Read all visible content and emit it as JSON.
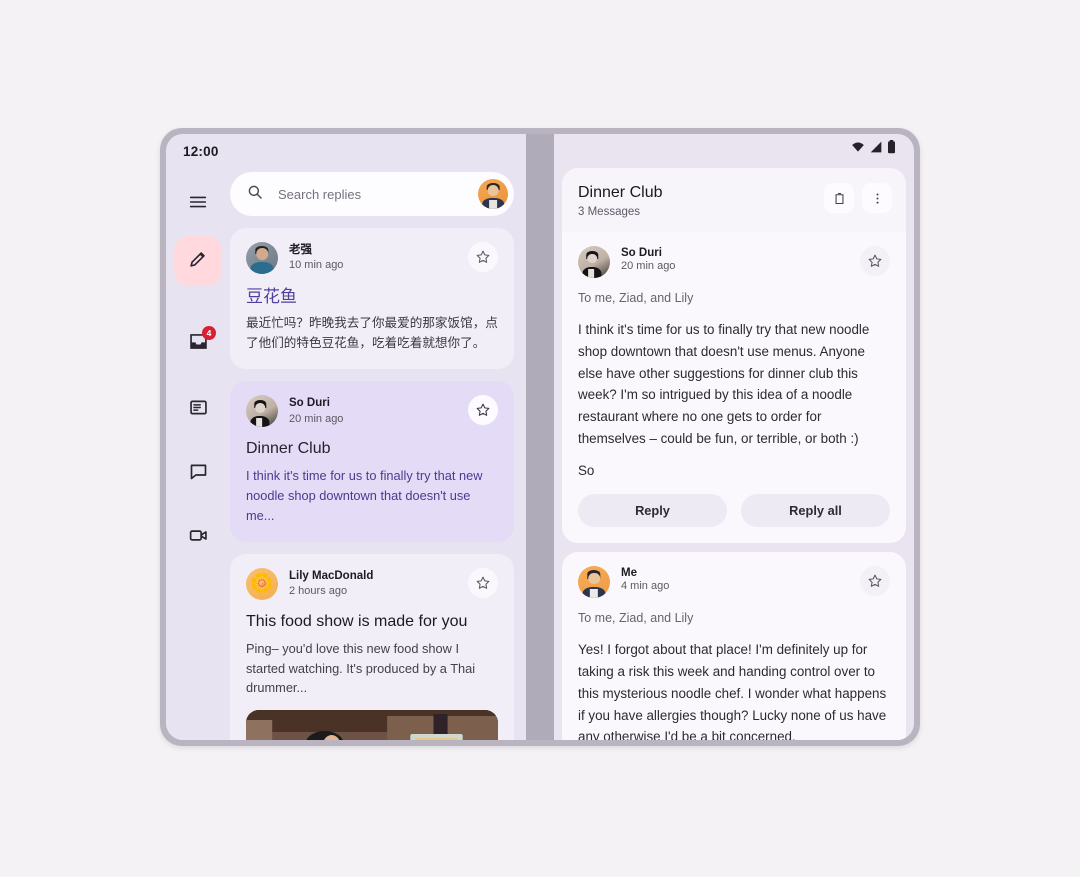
{
  "status_bar": {
    "time": "12:00",
    "wifi": "wifi-icon",
    "signal": "signal-icon",
    "battery": "battery-icon"
  },
  "rail": {
    "items": [
      {
        "name": "menu",
        "icon": "hamburger-menu-icon",
        "label": "Menu"
      },
      {
        "name": "compose",
        "icon": "pencil-edit-icon",
        "label": "Compose",
        "selected": true
      },
      {
        "name": "inbox",
        "icon": "inbox-icon",
        "label": "Inbox",
        "badge": "4"
      },
      {
        "name": "articles",
        "icon": "article-icon",
        "label": "Articles"
      },
      {
        "name": "chat",
        "icon": "chat-bubble-icon",
        "label": "Chat"
      },
      {
        "name": "video",
        "icon": "video-camera-icon",
        "label": "Video"
      }
    ]
  },
  "search": {
    "placeholder": "Search replies",
    "icon": "search-icon",
    "avatar": "user-avatar"
  },
  "message_list": [
    {
      "sender": "老强",
      "time": "10 min ago",
      "title": "豆花鱼",
      "snippet": "最近忙吗？昨晚我去了你最爱的那家饭馆，点了他们的特色豆花鱼，吃着吃着就想你了。",
      "selected": false,
      "avatar": "qiang-avatar",
      "star": "star-outline-icon"
    },
    {
      "sender": "So Duri",
      "time": "20 min ago",
      "title": "Dinner Club",
      "snippet": "I think it's time for us to finally try that new noodle shop downtown that doesn't use me...",
      "selected": true,
      "avatar": "soduri-avatar",
      "star": "star-outline-icon"
    },
    {
      "sender": "Lily MacDonald",
      "time": "2 hours ago",
      "title": "This food show is made for you",
      "snippet": "Ping– you'd love this new food show I started watching. It's produced by a Thai drummer...",
      "selected": false,
      "avatar": "lily-avatar",
      "star": "star-outline-icon",
      "photo": "kitchen-cooking-photo"
    }
  ],
  "thread": {
    "title": "Dinner Club",
    "subtitle": "3 Messages",
    "delete_icon": "trash-icon",
    "more_icon": "more-vertical-icon",
    "messages": [
      {
        "sender": "So Duri",
        "time": "20 min ago",
        "recipients": "To me, Ziad, and Lily",
        "body": "I think it's time for us to finally try that new noodle shop downtown that doesn't use menus. Anyone else have other suggestions for dinner club this week? I'm so intrigued by this idea of a noodle restaurant where no one gets to order for themselves – could be fun, or terrible, or both :)",
        "signature": "So",
        "avatar": "soduri-avatar",
        "star": "star-outline-icon",
        "actions": {
          "reply": "Reply",
          "reply_all": "Reply all"
        }
      },
      {
        "sender": "Me",
        "time": "4 min ago",
        "recipients": "To me, Ziad, and Lily",
        "body": "Yes! I forgot about that place! I'm definitely up for taking a risk this week and handing control over to this mysterious noodle chef. I wonder what happens if you have allergies though? Lucky none of us have any otherwise I'd be a bit concerned.",
        "avatar": "me-avatar",
        "star": "star-outline-icon"
      }
    ]
  },
  "colors": {
    "page_background": "#f4f2f5",
    "device_bezel": "#b9b4c0",
    "left_pane": "#e8e3f0",
    "right_pane": "#e9e4f0",
    "card": "#f2eef7",
    "card_selected": "#e4dbf7",
    "accent_purple": "#533f9e",
    "fab_background": "#ffd9de",
    "badge_red": "#d91f35",
    "avatar_orange": "#ef9a45"
  }
}
